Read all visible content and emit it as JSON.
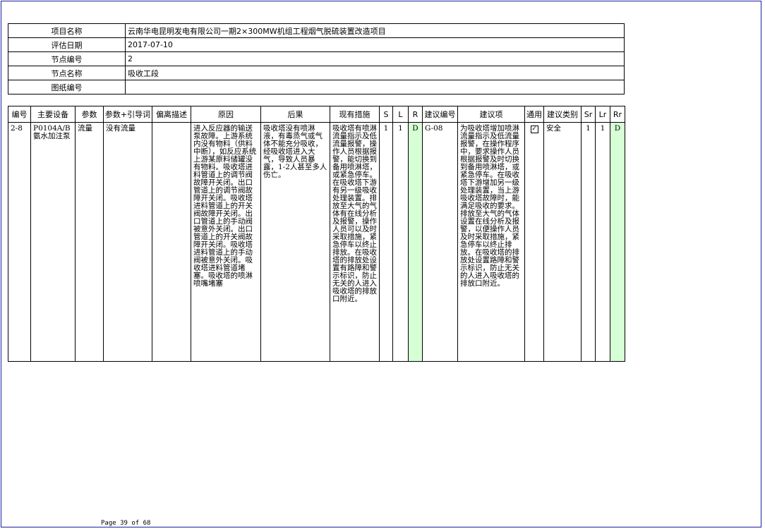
{
  "info": {
    "rows": [
      {
        "label": "项目名称",
        "value": "云南华电昆明发电有限公司一期2×300MW机组工程烟气脱硫装置改造项目"
      },
      {
        "label": "评估日期",
        "value": "2017-07-10"
      },
      {
        "label": "节点编号",
        "value": "2"
      },
      {
        "label": "节点名称",
        "value": "吸收工段"
      },
      {
        "label": "图纸编号",
        "value": ""
      }
    ]
  },
  "table": {
    "headers": {
      "id": "编号",
      "equipment": "主要设备",
      "param": "参数",
      "guideword": "参数+引导词",
      "deviation": "偏离描述",
      "cause": "原因",
      "consequence": "后果",
      "measures": "现有措施",
      "s": "S",
      "l": "L",
      "r": "R",
      "rec_id": "建议编号",
      "recommendation": "建议项",
      "general": "通用",
      "rec_type": "建议类别",
      "sr": "Sr",
      "lr": "Lr",
      "rr": "Rr"
    },
    "row": {
      "id": "2-8",
      "equipment": "P0104A/B氨水加注泵",
      "param": "流量",
      "guideword": "没有流量",
      "deviation": "",
      "cause": "进入反应器的输送泵故障。上游系统内没有物料（供料中断），如反应系统上游某原料储罐没有物料。吸收塔进料管道上的调节阀故障开关闭。出口管道上的调节阀故障开关闭。吸收塔进料管道上的开关阀故障开关闭。出口管道上的手动阀被意外关闭。出口管道上的开关阀故障开关闭。吸收塔进料管道上的手动阀被意外关闭。吸收塔进料管道堵塞。吸收塔的喷淋喷嘴堵塞",
      "consequence": "吸收塔没有喷淋液，有毒烝气或气体不能充分吸收，经吸收塔进入大气，导致人员暴露，1-2人甚至多人伤亡。",
      "measures": "吸收塔有喷淋流量指示及低流量报警，操作人员根据报警，能切换到备用喷淋塔，或紧急停车。在吸收塔下游有另一级吸收处理装置。排放至大气的气体有在线分析及报警，操作人员可以及时采取措施，紧急停车以终止排放。在吸收塔的排放处设置有路障和警示标识，防止无关的人进入吸收塔的排放口附近。",
      "s": "1",
      "l": "1",
      "r": "D",
      "rec_id": "G-08",
      "recommendation": "为吸收塔增加喷淋流量指示及低流量报警，在操作程序中，要求操作人员根据报警及时切换到备用喷淋塔，或紧急停车。在吸收塔下游增加另一级处理装置，当上游吸收塔故障时，能满足吸收的要求。排放至大气的气体设置在线分析及报警，以便操作人员及时采取措施，紧急停车以终止排放。在吸收塔的排放处设置路障和警示标识，防止无关的人进入吸收塔的排放口附近。",
      "general_checked": "✓",
      "rec_type": "安全",
      "sr": "1",
      "lr": "1",
      "rr": "D"
    }
  },
  "footer": {
    "page": "Page 39 of 68"
  },
  "colors": {
    "frame": "#1c1ca0",
    "risk_cell": "#d6ffd6"
  }
}
